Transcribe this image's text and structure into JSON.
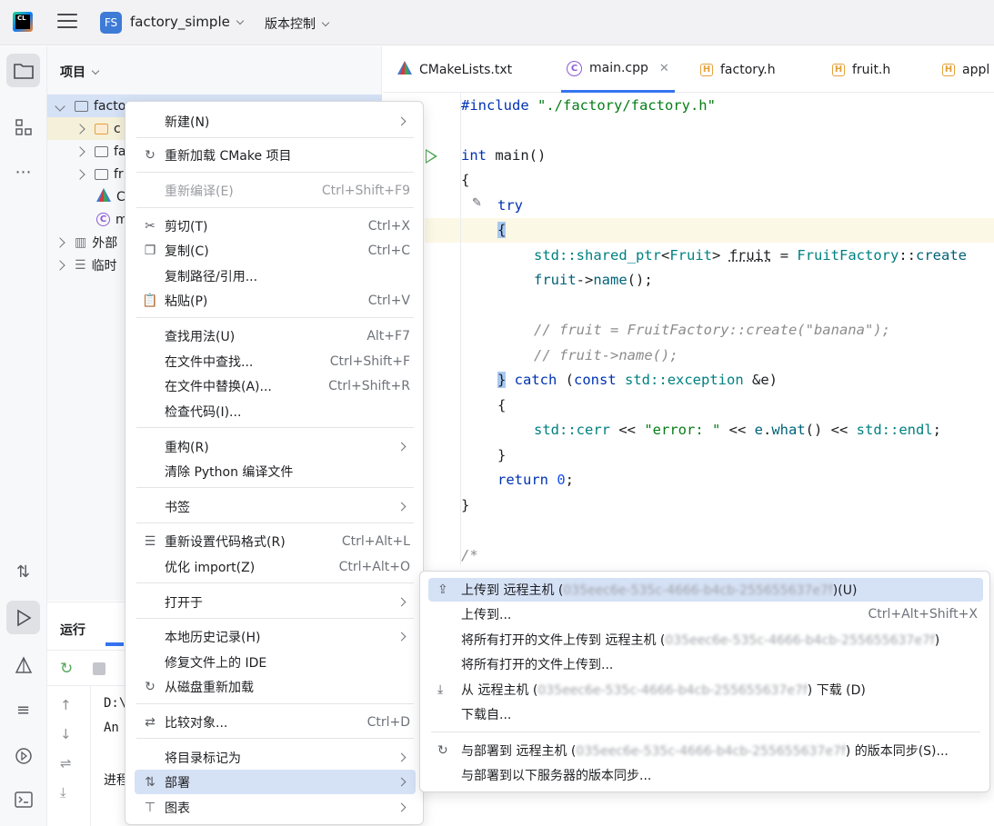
{
  "titlebar": {
    "logo_text": "CL",
    "project_badge": "FS",
    "project_name": "factory_simple",
    "vcs_label": "版本控制"
  },
  "project_panel": {
    "header": "项目",
    "tree": [
      {
        "label": "facto",
        "type": "folder"
      },
      {
        "label": "c",
        "type": "folder-orange"
      },
      {
        "label": "fa",
        "type": "folder"
      },
      {
        "label": "fr",
        "type": "folder"
      },
      {
        "label": "C",
        "type": "cmake"
      },
      {
        "label": "m",
        "type": "cpp"
      },
      {
        "label": "外部",
        "type": "library"
      },
      {
        "label": "临时",
        "type": "scratch"
      }
    ]
  },
  "run_panel": {
    "title": "运行",
    "console": [
      "D:\\",
      "An",
      "",
      "进程"
    ]
  },
  "tabs": [
    {
      "label": "CMakeLists.txt",
      "icon": "cmake-icon"
    },
    {
      "label": "main.cpp",
      "icon": "cpp-icon",
      "active": true
    },
    {
      "label": "factory.h",
      "icon": "header-icon"
    },
    {
      "label": "fruit.h",
      "icon": "header-icon"
    },
    {
      "label": "appl",
      "icon": "header-icon"
    }
  ],
  "editor": {
    "lines": {
      "l1_a": "#include ",
      "l1_b": "\"./factory/factory.h\"",
      "l3_a": "int",
      "l3_b": " main()",
      "l4": "{",
      "l5": "try",
      "l6": "{",
      "l7_a": "std::",
      "l7_b": "shared_ptr",
      "l7_c": "<",
      "l7_d": "Fruit",
      "l7_e": "> ",
      "l7_f": "fruit",
      "l7_g": " = ",
      "l7_h": "FruitFactory",
      "l7_i": "::",
      "l7_j": "create",
      "l8_a": "fruit",
      "l8_b": "->",
      "l8_c": "name",
      "l8_d": "();",
      "l10": "// fruit = FruitFactory::create(\"banana\");",
      "l11": "// fruit->name();",
      "l12_a": "}",
      "l12_b": " catch",
      "l12_c": " (",
      "l12_d": "const",
      "l12_e": " std::",
      "l12_f": "exception",
      "l12_g": " &e)",
      "l13": "{",
      "l14_a": "std::",
      "l14_b": "cerr",
      "l14_c": " << ",
      "l14_d": "\"error: \"",
      "l14_e": " << ",
      "l14_f": "e",
      "l14_g": ".",
      "l14_h": "what",
      "l14_i": "() << ",
      "l14_j": "std::",
      "l14_k": "endl",
      "l14_l": ";",
      "l15": "}",
      "l16_a": "return",
      "l16_b": " 0",
      "l16_c": ";",
      "l17": "}",
      "l19": "/*"
    }
  },
  "context_menu": {
    "items": [
      {
        "label": "新建(N)",
        "submenu": true
      },
      {
        "label": "重新加载 CMake 项目",
        "icon": "reload-icon"
      },
      {
        "label": "重新编译(E)",
        "shortcut": "Ctrl+Shift+F9",
        "disabled": true
      },
      {
        "label": "剪切(T)",
        "shortcut": "Ctrl+X",
        "icon": "scissors-icon"
      },
      {
        "label": "复制(C)",
        "shortcut": "Ctrl+C",
        "icon": "copy-icon"
      },
      {
        "label": "复制路径/引用..."
      },
      {
        "label": "粘贴(P)",
        "shortcut": "Ctrl+V",
        "icon": "paste-icon"
      },
      {
        "label": "查找用法(U)",
        "shortcut": "Alt+F7"
      },
      {
        "label": "在文件中查找...",
        "shortcut": "Ctrl+Shift+F"
      },
      {
        "label": "在文件中替换(A)...",
        "shortcut": "Ctrl+Shift+R"
      },
      {
        "label": "检查代码(I)..."
      },
      {
        "label": "重构(R)",
        "submenu": true
      },
      {
        "label": "清除 Python 编译文件"
      },
      {
        "label": "书签",
        "submenu": true
      },
      {
        "label": "重新设置代码格式(R)",
        "shortcut": "Ctrl+Alt+L",
        "icon": "format-icon"
      },
      {
        "label": "优化 import(Z)",
        "shortcut": "Ctrl+Alt+O"
      },
      {
        "label": "打开于",
        "submenu": true
      },
      {
        "label": "本地历史记录(H)",
        "submenu": true
      },
      {
        "label": "修复文件上的 IDE"
      },
      {
        "label": "从磁盘重新加载",
        "icon": "reload-icon"
      },
      {
        "label": "比较对象...",
        "shortcut": "Ctrl+D",
        "icon": "compare-icon"
      },
      {
        "label": "将目录标记为",
        "submenu": true
      },
      {
        "label": "部署",
        "submenu": true,
        "icon": "deploy-icon",
        "hover": true
      },
      {
        "label": "图表",
        "submenu": true,
        "icon": "diagram-icon"
      }
    ]
  },
  "submenu": {
    "host_id": "035eec6e-535c-4666-b4cb-255655637e7f",
    "items": [
      {
        "pre": "上传到 远程主机 (",
        "post": ")(U)",
        "icon": "upload-icon",
        "hover": true
      },
      {
        "label": "上传到...",
        "shortcut": "Ctrl+Alt+Shift+X"
      },
      {
        "pre": "将所有打开的文件上传到 远程主机 (",
        "post": ")"
      },
      {
        "label": "将所有打开的文件上传到..."
      },
      {
        "pre": "从 远程主机 (",
        "post": ") 下载 (D)",
        "icon": "download-icon"
      },
      {
        "label": "下载自..."
      },
      {
        "pre": "与部署到 远程主机 (",
        "post": ") 的版本同步(S)...",
        "icon": "sync-icon"
      },
      {
        "label": "与部署到以下服务器的版本同步..."
      }
    ]
  }
}
